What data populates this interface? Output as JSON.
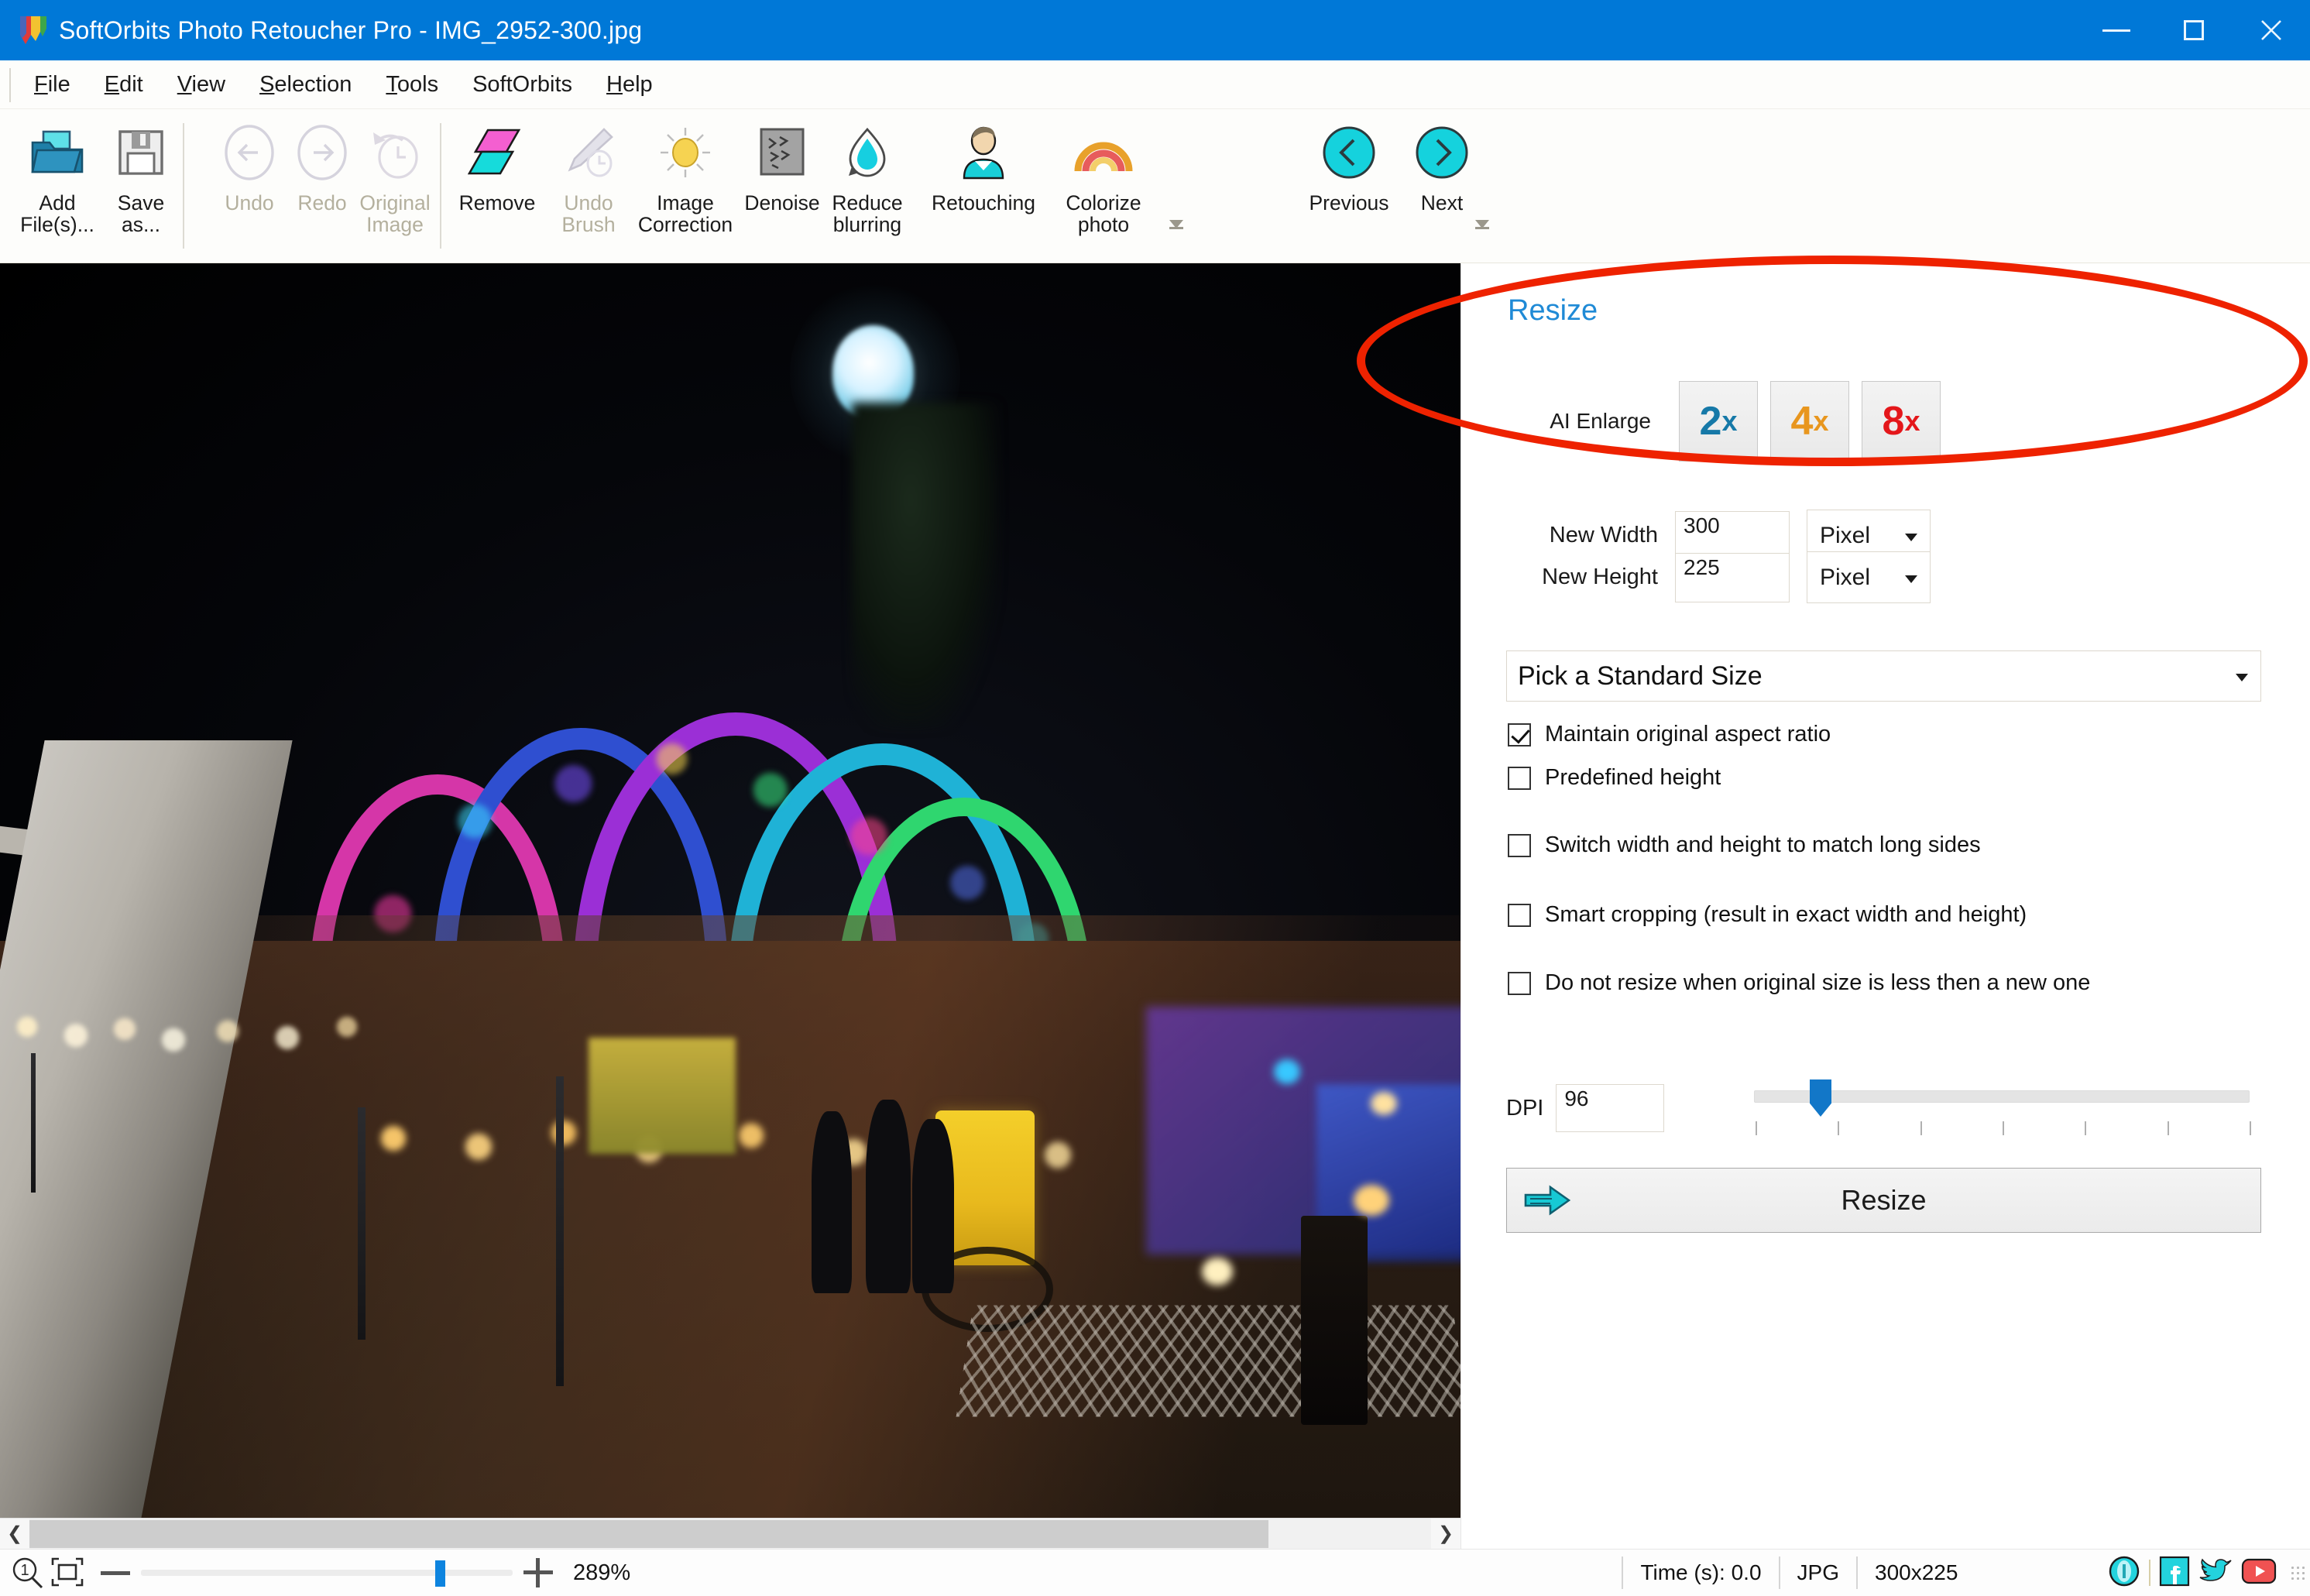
{
  "window": {
    "title": "SoftOrbits Photo Retoucher Pro - IMG_2952-300.jpg",
    "logo_icon": "softorbits-logo-icon",
    "controls": {
      "minimize": "minimize-icon",
      "maximize": "maximize-icon",
      "close": "close-icon"
    }
  },
  "menubar": {
    "items": [
      {
        "label": "File",
        "mnemonic": "F"
      },
      {
        "label": "Edit",
        "mnemonic": "E"
      },
      {
        "label": "View",
        "mnemonic": "V"
      },
      {
        "label": "Selection",
        "mnemonic": "S"
      },
      {
        "label": "Tools",
        "mnemonic": "T"
      },
      {
        "label": "SoftOrbits",
        "mnemonic": ""
      },
      {
        "label": "Help",
        "mnemonic": "H"
      }
    ]
  },
  "toolbar": {
    "buttons": [
      {
        "label": "Add\nFile(s)...",
        "icon": "open-folder-icon",
        "disabled": false
      },
      {
        "label": "Save\nas...",
        "icon": "floppy-save-icon",
        "disabled": false
      },
      {
        "label": "Undo",
        "icon": "undo-arrow-icon",
        "disabled": true
      },
      {
        "label": "Redo",
        "icon": "redo-arrow-icon",
        "disabled": true
      },
      {
        "label": "Original\nImage",
        "icon": "clock-revert-icon",
        "disabled": true
      },
      {
        "label": "Remove",
        "icon": "remove-swatch-icon",
        "disabled": false
      },
      {
        "label": "Undo\nBrush",
        "icon": "undo-brush-icon",
        "disabled": true
      },
      {
        "label": "Image\nCorrection",
        "icon": "sun-brightness-icon",
        "disabled": false
      },
      {
        "label": "Denoise",
        "icon": "denoise-grain-icon",
        "disabled": false
      },
      {
        "label": "Reduce\nblurring",
        "icon": "droplet-deblur-icon",
        "disabled": false
      },
      {
        "label": "Retouching",
        "icon": "person-portrait-icon",
        "disabled": false
      },
      {
        "label": "Colorize\nphoto",
        "icon": "rainbow-colorize-icon",
        "disabled": false
      },
      {
        "label": "Previous",
        "icon": "chevron-left-circle-icon",
        "disabled": false
      },
      {
        "label": "Next",
        "icon": "chevron-right-circle-icon",
        "disabled": false
      }
    ],
    "expand_icon": "ribbon-expand-icon"
  },
  "panel": {
    "title": "Resize",
    "title_color": "#1f8ad6",
    "ai_enlarge": {
      "label": "AI Enlarge",
      "options": [
        {
          "value": "2",
          "suffix": "x",
          "color": "#1679a8"
        },
        {
          "value": "4",
          "suffix": "x",
          "color": "#e8961e"
        },
        {
          "value": "8",
          "suffix": "x",
          "color": "#e4171b"
        }
      ]
    },
    "new_width": {
      "label": "New Width",
      "value": "300",
      "unit": "Pixel"
    },
    "new_height": {
      "label": "New Height",
      "value": "225",
      "unit": "Pixel"
    },
    "standard_size": {
      "value": "Pick a Standard Size"
    },
    "checkboxes": [
      {
        "label": "Maintain original aspect ratio",
        "checked": true
      },
      {
        "label": "Predefined height",
        "checked": false
      },
      {
        "label": "Switch width and height to match long sides",
        "checked": false
      },
      {
        "label": "Smart cropping (result in exact width and height)",
        "checked": false
      },
      {
        "label": "Do not resize when original size is less then a new one",
        "checked": false
      }
    ],
    "dpi": {
      "label": "DPI",
      "value": "96",
      "slider_ticks": 7,
      "slider_position_pct": 11
    },
    "resize_button": {
      "label": "Resize",
      "icon": "right-arrow-icon"
    }
  },
  "annotation": {
    "shape": "ellipse",
    "color": "#ee2200"
  },
  "canvas": {
    "scrollbar": {
      "left_arrow": "chevron-left-icon",
      "right_arrow": "chevron-right-icon"
    }
  },
  "statusbar": {
    "zoom_one_to_one_icon": "zoom-actual-size-icon",
    "fit_icon": "fit-to-window-icon",
    "minus_icon": "zoom-out-icon",
    "plus_icon": "zoom-in-icon",
    "zoom_percent": "289%",
    "time": "Time (s): 0.0",
    "format": "JPG",
    "dimensions": "300x225",
    "social": [
      {
        "name": "info-icon",
        "color": "#18cfd8"
      },
      {
        "name": "facebook-icon",
        "color": "#18cfd8"
      },
      {
        "name": "twitter-icon",
        "color": "#18cfd8"
      },
      {
        "name": "youtube-icon",
        "color": "#ef4b4b"
      }
    ],
    "resize_grip_icon": "resize-grip-icon"
  }
}
